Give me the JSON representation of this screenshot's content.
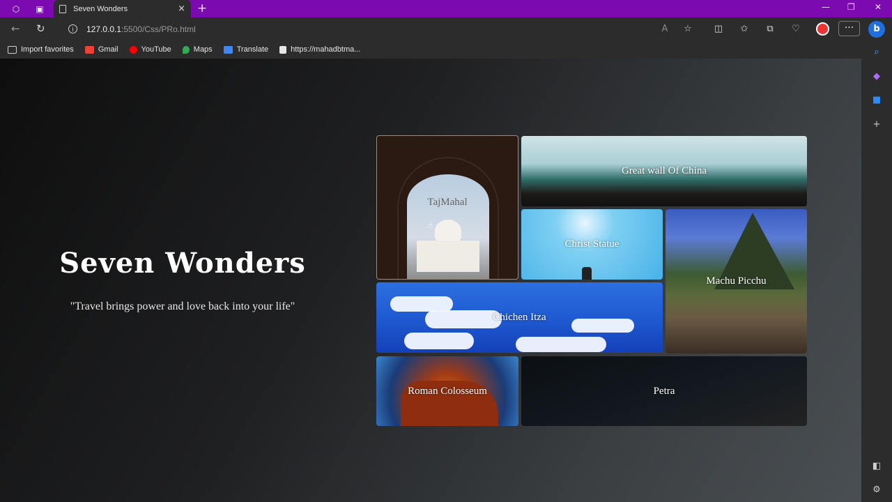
{
  "browser": {
    "tab_title": "Seven Wonders",
    "new_tab_symbol": "+",
    "close_tab_symbol": "×",
    "address_host": "127.0.0.1",
    "address_path": ":5500/Css/PRo.html",
    "bookmarks": [
      {
        "label": "Import favorites",
        "color": "#cfcfcf"
      },
      {
        "label": "Gmail",
        "color": "#ea4335"
      },
      {
        "label": "YouTube",
        "color": "#ff0000"
      },
      {
        "label": "Maps",
        "color": "#34a853"
      },
      {
        "label": "Translate",
        "color": "#4285f4"
      },
      {
        "label": "https://mahadbtma...",
        "color": "#e6e6e6"
      }
    ],
    "accent_color": "#7b0ab0"
  },
  "hero": {
    "title": "Seven Wonders",
    "quote": "\"Travel brings power and love back into your life\""
  },
  "gallery": {
    "taj": "TajMahal",
    "wall": "Great wall Of China",
    "christ": "Christ Statue",
    "machu": "Machu Picchu",
    "chichen": "Chichen Itza",
    "colosseum": "Roman Colosseum",
    "petra": "Petra"
  }
}
